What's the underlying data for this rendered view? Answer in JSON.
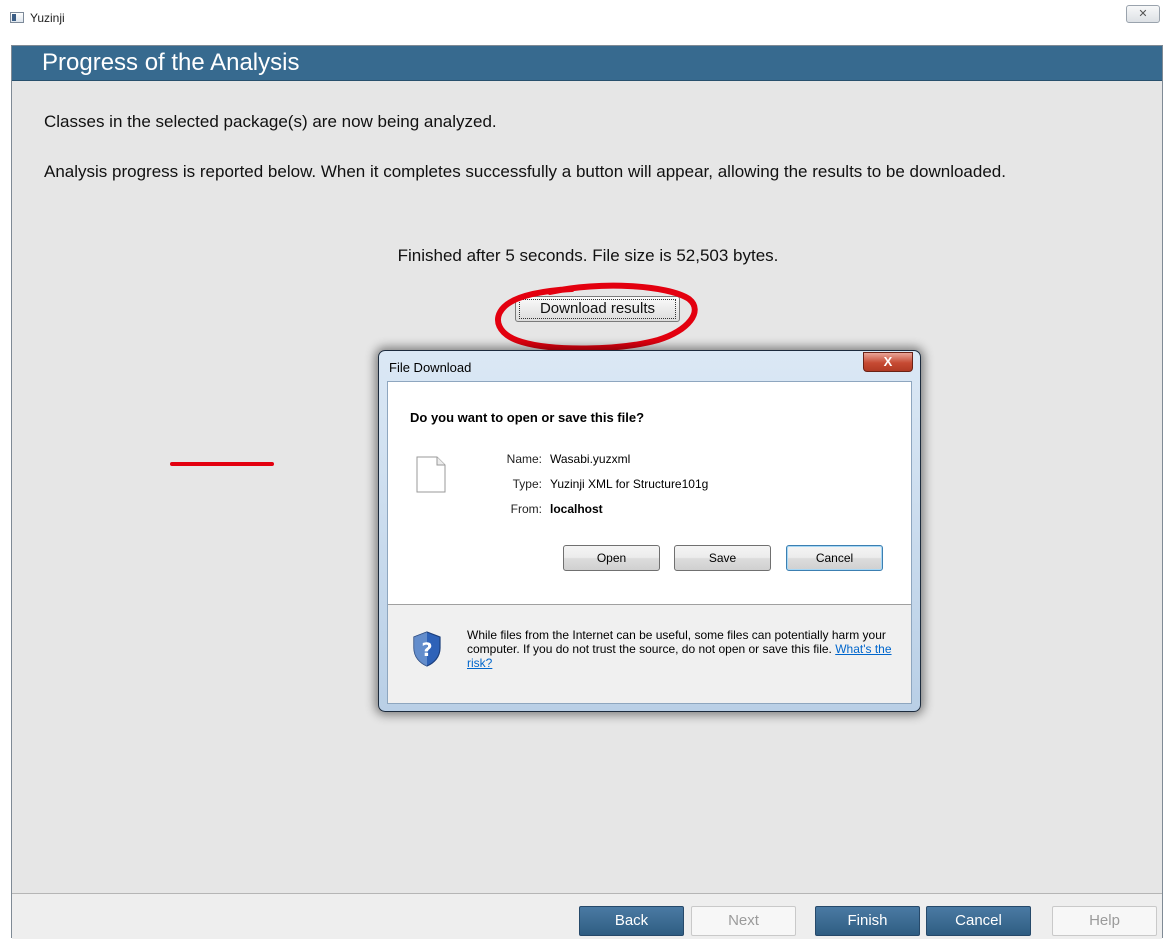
{
  "window": {
    "title": "Yuzinji",
    "close_glyph": "✕"
  },
  "wizard": {
    "page_title": "Progress of the Analysis",
    "intro_line1": "Classes in the selected package(s) are now being analyzed.",
    "intro_line2": "Analysis progress is reported below. When it completes successfully a button will appear, allowing the results to be downloaded.",
    "status": "Finished after 5 seconds. File size is 52,503 bytes.",
    "download_label": "Download results",
    "buttons": {
      "back": "Back",
      "next": "Next",
      "finish": "Finish",
      "cancel": "Cancel",
      "help": "Help"
    },
    "button_states": {
      "back": "enabled",
      "next": "disabled",
      "finish": "enabled",
      "cancel": "enabled",
      "help": "disabled"
    }
  },
  "file_download_dialog": {
    "title": "File Download",
    "close_glyph": "X",
    "question": "Do you want to open or save this file?",
    "name_label": "Name:",
    "name_value": "Wasabi.yuzxml",
    "type_label": "Type:",
    "type_value": "Yuzinji XML for Structure101g",
    "from_label": "From:",
    "from_value": "localhost",
    "open_label": "Open",
    "save_label": "Save",
    "cancel_label": "Cancel",
    "warning_text": "While files from the Internet can be useful, some files can potentially harm your computer. If you do not trust the source, do not open or save this file.",
    "risk_link": "What's the risk?"
  },
  "annotations": {
    "marker_color": "#e3000f"
  },
  "colors": {
    "header_bg": "#376a8f",
    "button_active_bg": "#3a6890",
    "link": "#0066cc"
  }
}
